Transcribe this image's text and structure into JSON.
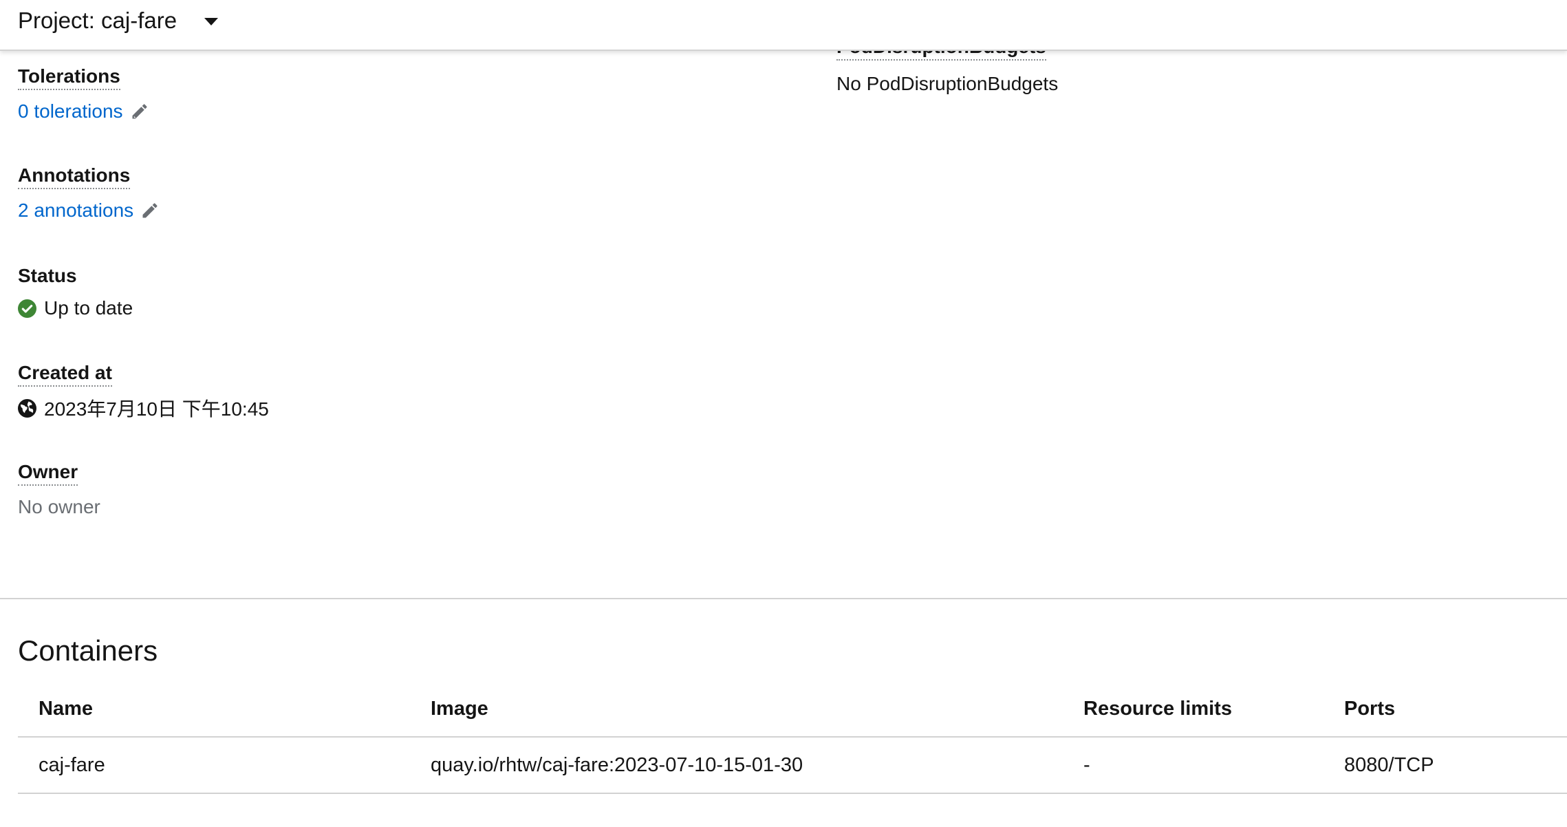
{
  "project_bar": {
    "label": "Project: caj-fare"
  },
  "details": {
    "tolerations": {
      "label": "Tolerations",
      "value": "0 tolerations"
    },
    "annotations": {
      "label": "Annotations",
      "value": "2 annotations"
    },
    "status": {
      "label": "Status",
      "value": "Up to date",
      "icon": "check-circle-icon",
      "color": "#3e8635"
    },
    "created_at": {
      "label": "Created at",
      "value": "2023年7月10日 下午10:45",
      "icon": "globe-icon"
    },
    "owner": {
      "label": "Owner",
      "value": "No owner"
    },
    "pod_disruption_budgets": {
      "label": "PodDisruptionBudgets",
      "value": "No PodDisruptionBudgets"
    }
  },
  "containers": {
    "title": "Containers",
    "columns": [
      "Name",
      "Image",
      "Resource limits",
      "Ports"
    ],
    "rows": [
      {
        "name": "caj-fare",
        "image": "quay.io/rhtw/caj-fare:2023-07-10-15-01-30",
        "resource_limits": "-",
        "ports": "8080/TCP"
      }
    ]
  },
  "colors": {
    "link": "#0066cc",
    "muted": "#6a6e73",
    "success": "#3e8635",
    "border": "#d2d2d2"
  }
}
